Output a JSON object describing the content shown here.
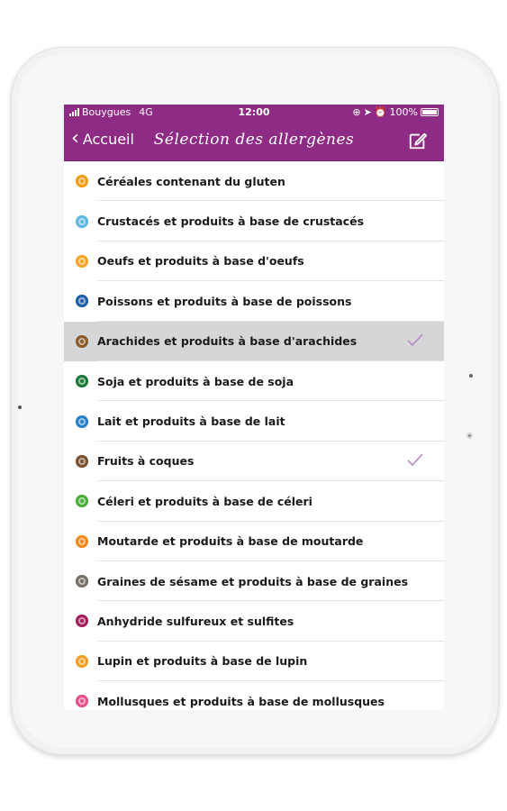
{
  "status_bar": {
    "carrier": "Bouygues",
    "network": "4G",
    "time": "12:00",
    "battery": "100%"
  },
  "nav": {
    "back_label": "Accueil",
    "title": "Sélection des allergènes"
  },
  "colors": {
    "brand": "#8e2b84",
    "check": "#b38cc4",
    "selected_row": "#d6d6d8"
  },
  "allergens": [
    {
      "label": "Céréales contenant du gluten",
      "icon": "gluten-icon",
      "color": "#f39c12",
      "checked": false,
      "selected": false
    },
    {
      "label": "Crustacés et produits à base de crustacés",
      "icon": "crustacean-icon",
      "color": "#5fb8e0",
      "checked": false,
      "selected": false
    },
    {
      "label": "Oeufs et produits à base d'oeufs",
      "icon": "egg-icon",
      "color": "#f5a623",
      "checked": false,
      "selected": false
    },
    {
      "label": "Poissons et produits à base de poissons",
      "icon": "fish-icon",
      "color": "#1f5fa8",
      "checked": false,
      "selected": false
    },
    {
      "label": "Arachides et produits à base d'arachides",
      "icon": "peanut-icon",
      "color": "#8b5a2b",
      "checked": true,
      "selected": true
    },
    {
      "label": "Soja et produits à base de soja",
      "icon": "soy-icon",
      "color": "#1e7a3a",
      "checked": false,
      "selected": false
    },
    {
      "label": "Lait et produits à base de lait",
      "icon": "milk-icon",
      "color": "#2a7fc9",
      "checked": false,
      "selected": false
    },
    {
      "label": "Fruits à coques",
      "icon": "nut-icon",
      "color": "#7a5230",
      "checked": true,
      "selected": false
    },
    {
      "label": "Céleri et produits à base de céleri",
      "icon": "celery-icon",
      "color": "#4caf3a",
      "checked": false,
      "selected": false
    },
    {
      "label": "Moutarde et produits à base de moutarde",
      "icon": "mustard-icon",
      "color": "#f08a1c",
      "checked": false,
      "selected": false
    },
    {
      "label": "Graines de sésame et produits à base de graines",
      "icon": "sesame-icon",
      "color": "#777068",
      "checked": false,
      "selected": false
    },
    {
      "label": "Anhydride sulfureux et sulfites",
      "icon": "sulfite-icon",
      "color": "#a3205f",
      "checked": false,
      "selected": false
    },
    {
      "label": "Lupin et produits à base de lupin",
      "icon": "lupin-icon",
      "color": "#f0a020",
      "checked": false,
      "selected": false
    },
    {
      "label": "Mollusques et produits à base de mollusques",
      "icon": "mollusc-icon",
      "color": "#e8508c",
      "checked": false,
      "selected": false
    }
  ]
}
